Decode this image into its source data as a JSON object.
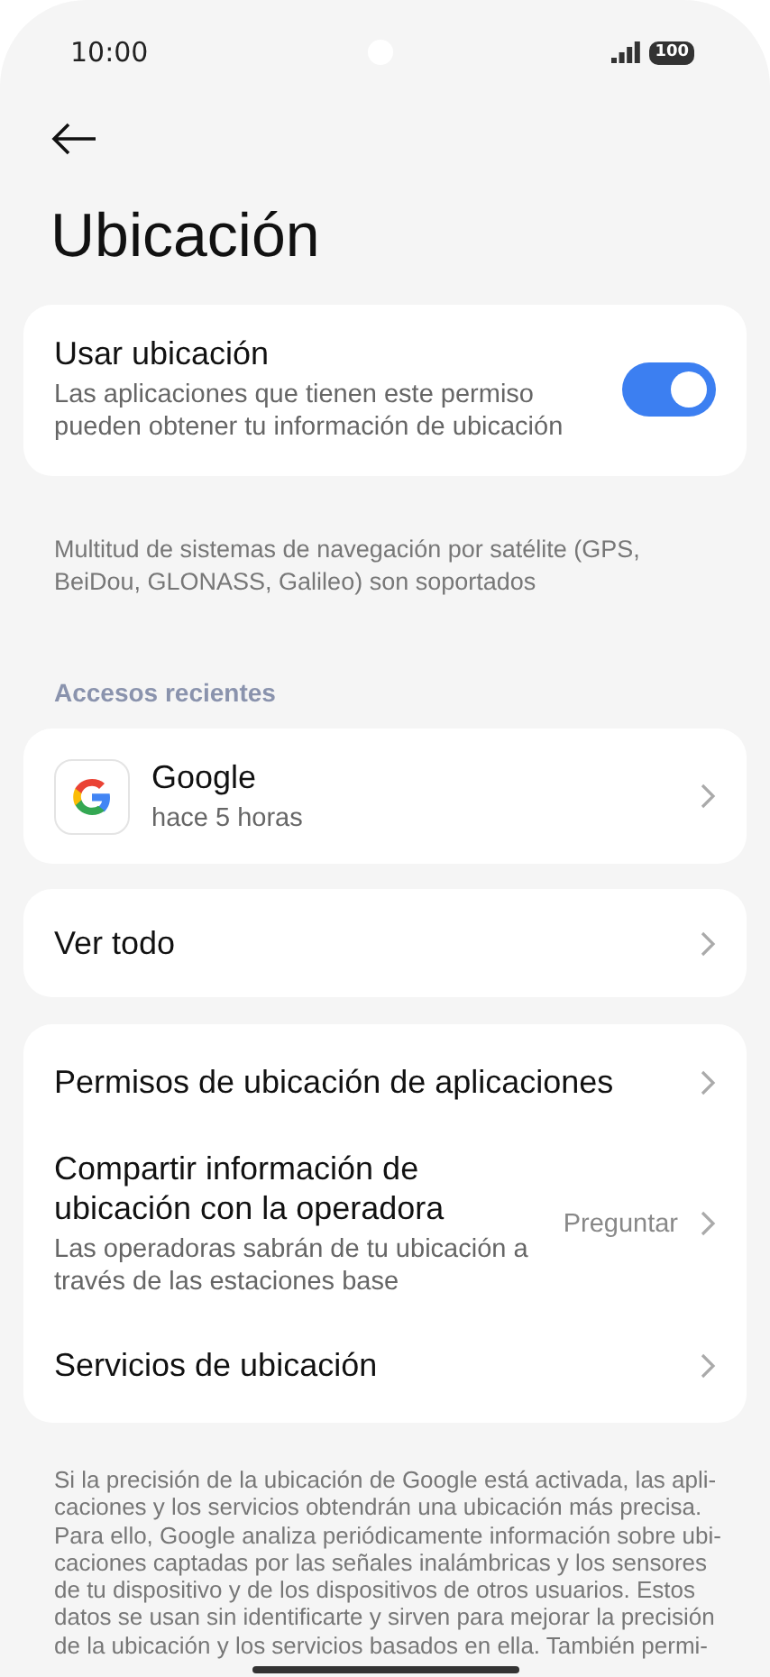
{
  "status_bar": {
    "time": "10:00",
    "battery": "100"
  },
  "title": "Ubicación",
  "location_toggle": {
    "label": "Usar ubicación",
    "description": "Las aplicaciones que tienen este permiso pueden obtener tu información de ubicación",
    "on": true
  },
  "gnss_note": "Multitud de sistemas de navegación por satélite (GPS, BeiDou, GLONASS, Galileo) son soportados",
  "recent_header": "Accesos recientes",
  "recent_apps": [
    {
      "name": "Google",
      "time": "hace 5 horas"
    }
  ],
  "see_all": "Ver todo",
  "settings": [
    {
      "label": "Permisos de ubicación de aplicaciones"
    },
    {
      "label": "Compartir información de ubicación con la operadora",
      "description": "Las operadoras sabrán de tu ubicación a través de las estaciones base",
      "value": "Preguntar"
    },
    {
      "label": "Servicios de ubicación"
    }
  ],
  "footer": "Si la precisión de la ubicación de Google está activada, las apli-\ncaciones y los servicios obtendrán una ubicación más precisa.\nPara ello, Google analiza periódicamente información sobre ubi-\ncaciones captadas por las señales inalámbricas y los sensores\nde tu dispositivo y de los dispositivos de otros usuarios. Estos\ndatos se usan sin identificarte y sirven para mejorar la precisión\nde la ubicación y los servicios basados en ella. También permi-"
}
